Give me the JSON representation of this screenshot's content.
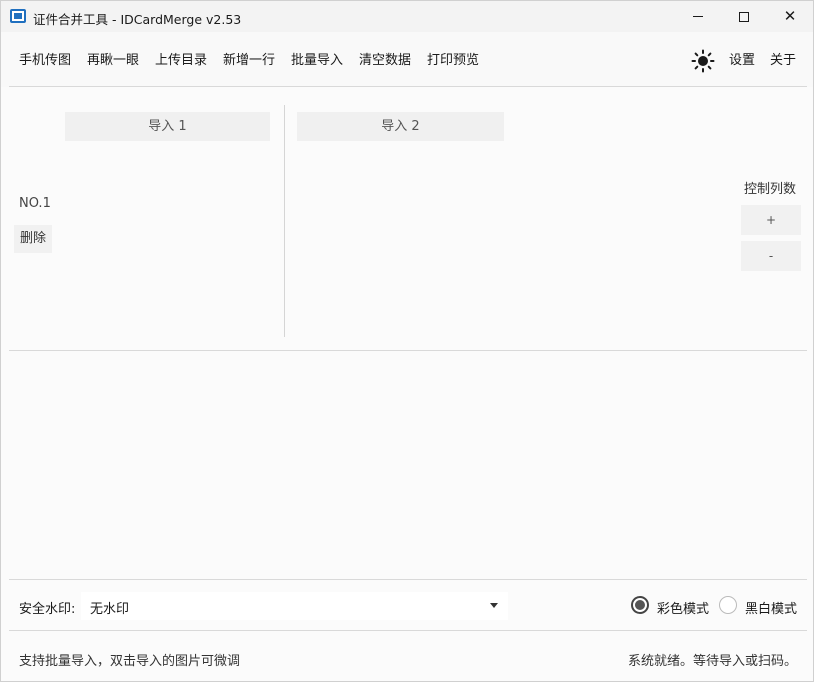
{
  "window": {
    "title": "证件合并工具 - IDCardMerge v2.53",
    "app_icon": "id-card-icon",
    "controls": {
      "minimize": "minimize-icon",
      "maximize": "maximize-icon",
      "close": "✕"
    }
  },
  "toolbar": {
    "items": [
      {
        "label": "手机传图"
      },
      {
        "label": "再瞅一眼"
      },
      {
        "label": "上传目录"
      },
      {
        "label": "新增一行"
      },
      {
        "label": "批量导入"
      },
      {
        "label": "清空数据"
      },
      {
        "label": "打印预览"
      }
    ],
    "theme_icon": "sun-icon",
    "settings_label": "设置",
    "about_label": "关于"
  },
  "grid": {
    "columns": [
      {
        "label": "导入 1"
      },
      {
        "label": "导入 2"
      }
    ],
    "rows": [
      {
        "label": "NO.1",
        "delete_label": "删除"
      }
    ]
  },
  "column_control": {
    "label": "控制列数",
    "plus_label": "+",
    "minus_label": "-"
  },
  "watermark": {
    "label": "安全水印:",
    "selected": "无水印"
  },
  "color_mode": {
    "options": [
      {
        "label": "彩色模式",
        "selected": true
      },
      {
        "label": "黑白模式",
        "selected": false
      }
    ]
  },
  "statusbar": {
    "hint": "支持批量导入，双击导入的图片可微调",
    "status": "系统就绪。等待导入或扫码。"
  },
  "colors": {
    "accent": "#1f6fbf",
    "background": "#fbfbfb",
    "button_bg": "#f1f1f1"
  }
}
